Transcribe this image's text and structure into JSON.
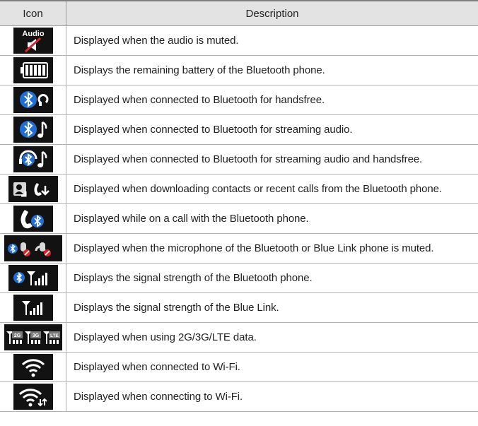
{
  "header": {
    "icon": "Icon",
    "description": "Description"
  },
  "rows": [
    {
      "icon": "audio-muted-icon",
      "icon_text": "Audio",
      "description": "Displayed when the audio is muted."
    },
    {
      "icon": "battery-icon",
      "description": "Displays the remaining battery of the Bluetooth phone."
    },
    {
      "icon": "bluetooth-handsfree-icon",
      "description": "Displayed when connected to Bluetooth for handsfree."
    },
    {
      "icon": "bluetooth-streaming-audio-icon",
      "description": "Displayed when connected to Bluetooth for streaming audio."
    },
    {
      "icon": "bluetooth-audio-handsfree-icon",
      "description": "Displayed when connected to Bluetooth for streaming audio and handsfree."
    },
    {
      "icon": "download-contacts-calls-icon",
      "description": "Displayed when downloading contacts or recent calls from the Bluetooth phone."
    },
    {
      "icon": "bluetooth-call-icon",
      "description": "Displayed while on a call with the Bluetooth phone."
    },
    {
      "icon": "microphone-muted-icon",
      "description": "Displayed when the microphone of the Bluetooth or Blue Link phone is muted."
    },
    {
      "icon": "bluetooth-signal-icon",
      "description": "Displays the signal strength of the Bluetooth phone."
    },
    {
      "icon": "bluelink-signal-icon",
      "description": "Displays the signal strength of the Blue Link."
    },
    {
      "icon": "data-2g-3g-lte-icon",
      "icon_texts": [
        "2G",
        "3G",
        "LTE"
      ],
      "description": "Displayed when using 2G/3G/LTE data."
    },
    {
      "icon": "wifi-connected-icon",
      "description": "Displayed when connected to Wi-Fi."
    },
    {
      "icon": "wifi-connecting-icon",
      "description": "Displayed when connecting to Wi-Fi."
    }
  ],
  "colors": {
    "header_bg": "#e3e3e3",
    "icon_bg": "#121212",
    "bluetooth_blue": "#1f6fd6",
    "mute_red": "#d9262b",
    "border": "#b3b3b3"
  }
}
